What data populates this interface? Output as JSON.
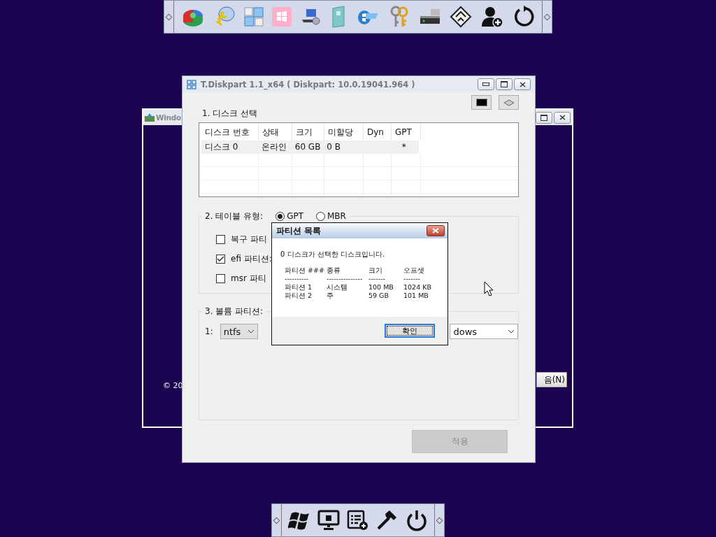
{
  "background_window": {
    "title": "Windo",
    "footer_text": "© 20",
    "next_button": "음(N)"
  },
  "main_window": {
    "title": "T.Diskpart 1.1_x64 ( Diskpart: 10.0.19041.964 )",
    "disk_section": {
      "label": "1. 디스크 선택",
      "columns": [
        "디스크 번호",
        "상태",
        "크기",
        "미할당",
        "Dyn",
        "GPT"
      ],
      "rows": [
        {
          "cells": [
            "디스크 0",
            "온라인",
            "60 GB",
            "0 B",
            "",
            "*"
          ],
          "selected": true
        }
      ]
    },
    "table_section": {
      "label": "2. 테이블 유형:",
      "options": [
        {
          "label": "GPT",
          "selected": true
        },
        {
          "label": "MBR",
          "selected": false
        }
      ],
      "checkboxes": [
        {
          "label": "복구 파티",
          "checked": false
        },
        {
          "label": "efi 파티션:",
          "checked": true
        },
        {
          "label": "msr 파티",
          "checked": false
        }
      ]
    },
    "volume_section": {
      "label": "3. 볼륨 파티션:",
      "row_label": "1:",
      "filesystem": "ntfs",
      "target": "dows"
    },
    "apply_button": {
      "label": "적용",
      "disabled": true
    }
  },
  "dialog": {
    "title": "파티션 목록",
    "message": "0 디스크가 선택한 디스크입니다.",
    "columns": [
      "파티션 ###",
      "종류",
      "크기",
      "오프셋"
    ],
    "separators": [
      "----------",
      "---------------",
      "-------",
      "-------"
    ],
    "rows": [
      [
        "파티션 1",
        "시스템",
        "100 MB",
        "1024 KB"
      ],
      [
        "파티션 2",
        "주",
        "59 GB",
        "101 MB"
      ]
    ],
    "ok_button": "확인"
  }
}
